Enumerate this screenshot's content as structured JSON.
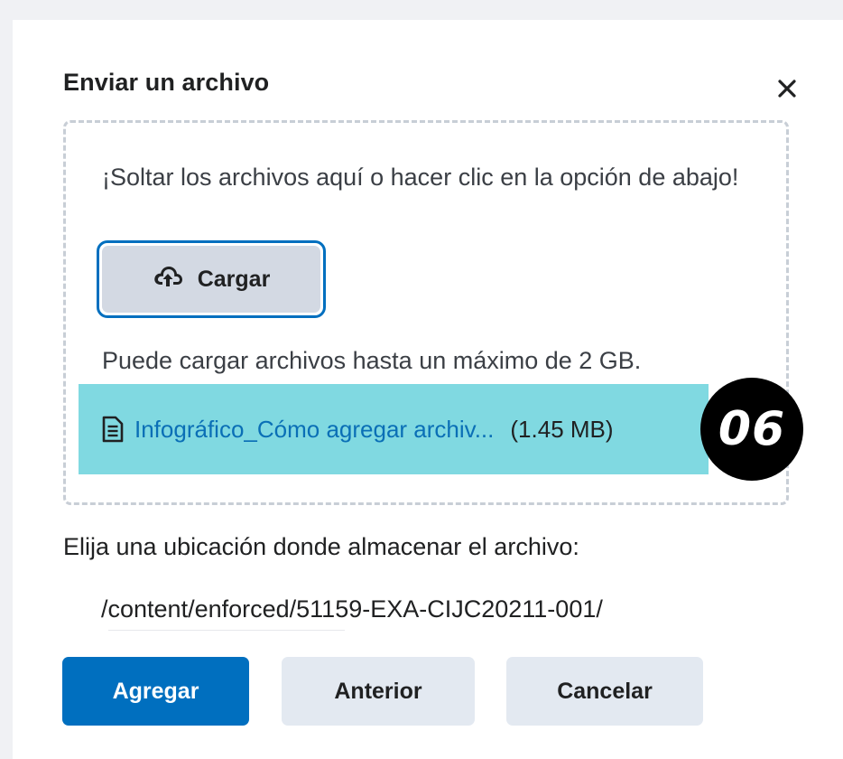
{
  "dialog": {
    "title": "Enviar un archivo",
    "close_icon": "close-icon"
  },
  "dropzone": {
    "instructions": "¡Soltar los archivos aquí o hacer clic en la opción de abajo!",
    "upload_button": {
      "label": "Cargar",
      "icon": "cloud-upload-icon"
    },
    "limit_text": "Puede cargar archivos hasta un máximo de 2 GB.",
    "file": {
      "icon": "document-icon",
      "name": "Infográfico_Cómo agregar archiv...",
      "size": "(1.45 MB)"
    },
    "step_badge": "06"
  },
  "location": {
    "label": "Elija una ubicación donde almacenar el archivo:",
    "path": "/content/enforced/51159-EXA-CIJC20211-001/"
  },
  "actions": {
    "add_label": "Agregar",
    "back_label": "Anterior",
    "cancel_label": "Cancelar"
  },
  "colors": {
    "primary": "#006fbf",
    "highlight": "#80d9e1",
    "secondary_button": "#e3e9f1",
    "link": "#0a6fb6"
  }
}
